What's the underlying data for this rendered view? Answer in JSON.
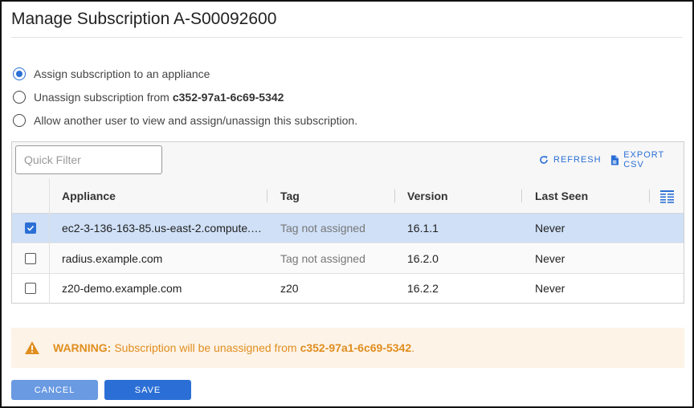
{
  "dialog": {
    "title": "Manage Subscription A-S00092600"
  },
  "options": [
    {
      "label": "Assign subscription to an appliance",
      "strong": "",
      "selected": true
    },
    {
      "label": "Unassign subscription from",
      "strong": "c352-97a1-6c69-5342",
      "selected": false
    },
    {
      "label": "Allow another user to view and assign/unassign this subscription.",
      "strong": "",
      "selected": false
    }
  ],
  "toolbar": {
    "quick_filter_placeholder": "Quick Filter",
    "quick_filter_value": "",
    "refresh_label": "REFRESH",
    "export_label": "EXPORT CSV",
    "refresh_icon": "refresh-icon",
    "export_icon": "file-export-icon"
  },
  "table": {
    "columns": [
      "Appliance",
      "Tag",
      "Version",
      "Last Seen"
    ],
    "columns_icon": "columns-menu-icon",
    "rows": [
      {
        "appliance": "ec2-3-136-163-85.us-east-2.compute.…",
        "tag": "Tag not assigned",
        "tag_assigned": false,
        "version": "16.1.1",
        "last_seen": "Never",
        "checked": true
      },
      {
        "appliance": "radius.example.com",
        "tag": "Tag not assigned",
        "tag_assigned": false,
        "version": "16.2.0",
        "last_seen": "Never",
        "checked": false
      },
      {
        "appliance": "z20-demo.example.com",
        "tag": "z20",
        "tag_assigned": true,
        "version": "16.2.2",
        "last_seen": "Never",
        "checked": false
      }
    ]
  },
  "warning": {
    "icon": "warning-triangle-icon",
    "label": "WARNING:",
    "message": "Subscription will be unassigned from",
    "appliance": "c352-97a1-6c69-5342",
    "suffix": "."
  },
  "buttons": {
    "cancel": "CANCEL",
    "save": "SAVE"
  },
  "colors": {
    "accent": "#2b6fd6",
    "selected_row": "#cfe0f7",
    "warning_text": "#e08e1f",
    "warning_bg": "#fdf3e7"
  }
}
